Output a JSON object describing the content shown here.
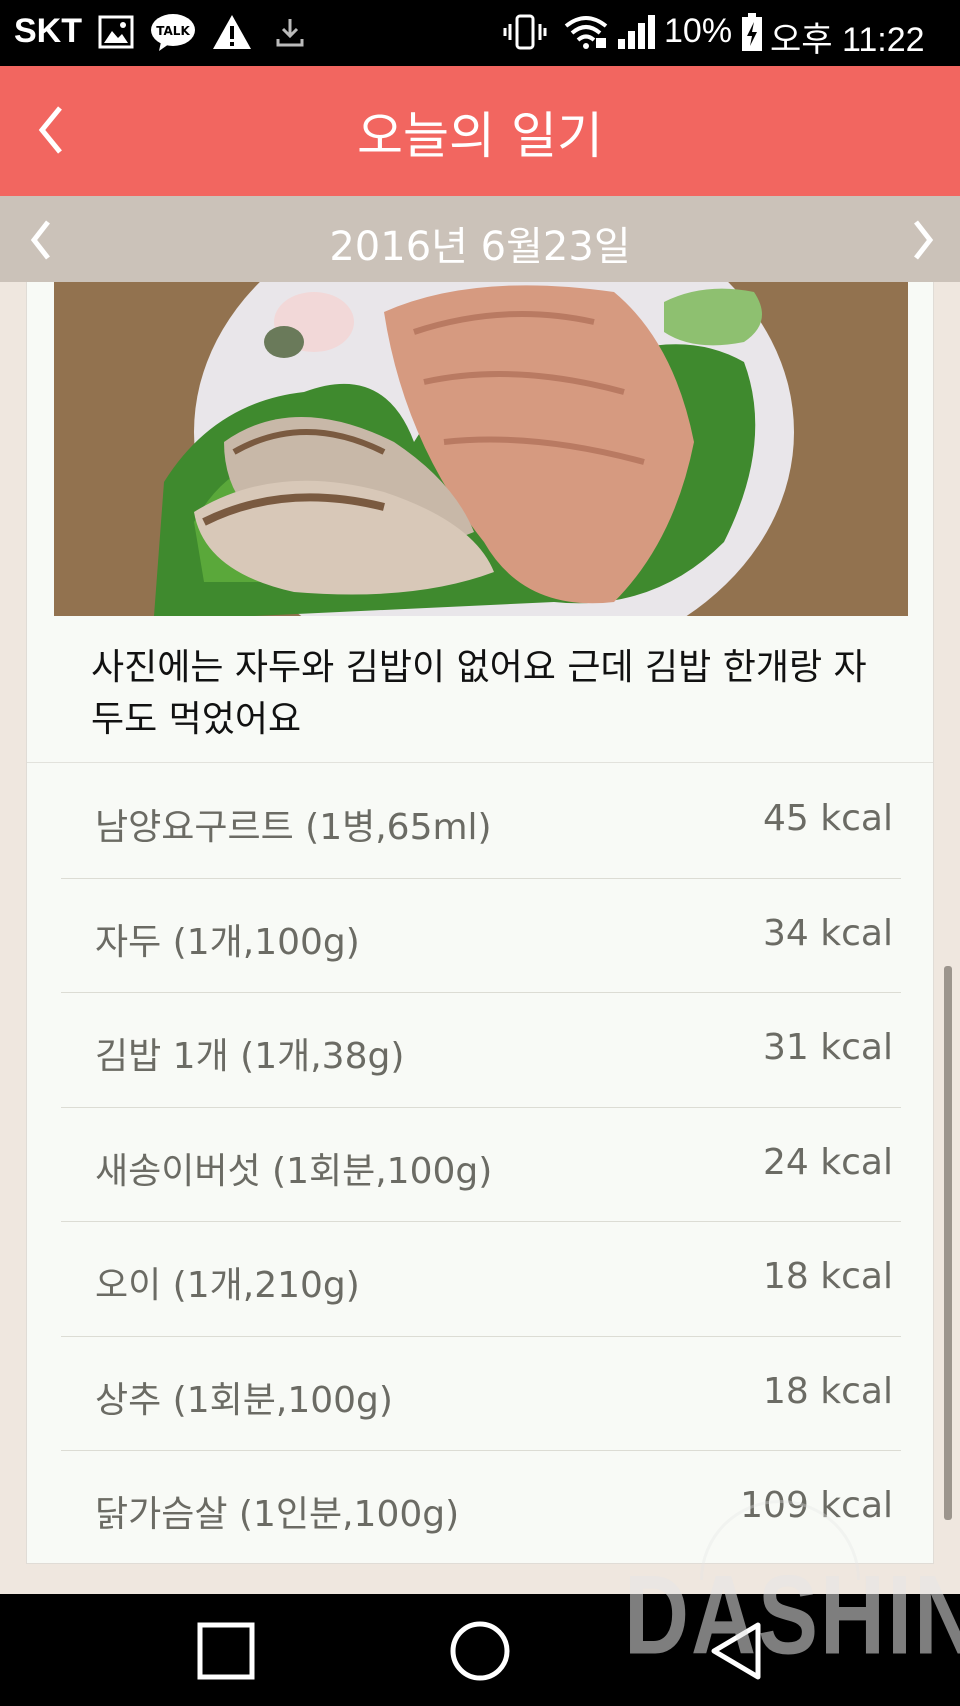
{
  "status_bar": {
    "carrier": "SKT",
    "battery": "10%",
    "time": "오후 11:22"
  },
  "header": {
    "title": "오늘의 일기"
  },
  "date_bar": {
    "date": "2016년 6월23일"
  },
  "memo": {
    "text": "사진에는 자두와 김밥이 없어요 근데 김밥 한개랑 자두도 먹었어요"
  },
  "foods": [
    {
      "name": "남양요구르트 (1병,65ml)",
      "kcal": "45 kcal"
    },
    {
      "name": "자두 (1개,100g)",
      "kcal": "34 kcal"
    },
    {
      "name": "김밥 1개 (1개,38g)",
      "kcal": "31 kcal"
    },
    {
      "name": "새송이버섯 (1회분,100g)",
      "kcal": "24 kcal"
    },
    {
      "name": "오이 (1개,210g)",
      "kcal": "18 kcal"
    },
    {
      "name": "상추 (1회분,100g)",
      "kcal": "18 kcal"
    },
    {
      "name": "닭가슴살 (1인분,100g)",
      "kcal": "109 kcal"
    }
  ],
  "watermark": "DASHIN",
  "colors": {
    "header_bg": "#f26660",
    "datebar_bg": "#cbc2b9",
    "page_bg": "#efe7df",
    "card_bg": "#f8faf6"
  }
}
